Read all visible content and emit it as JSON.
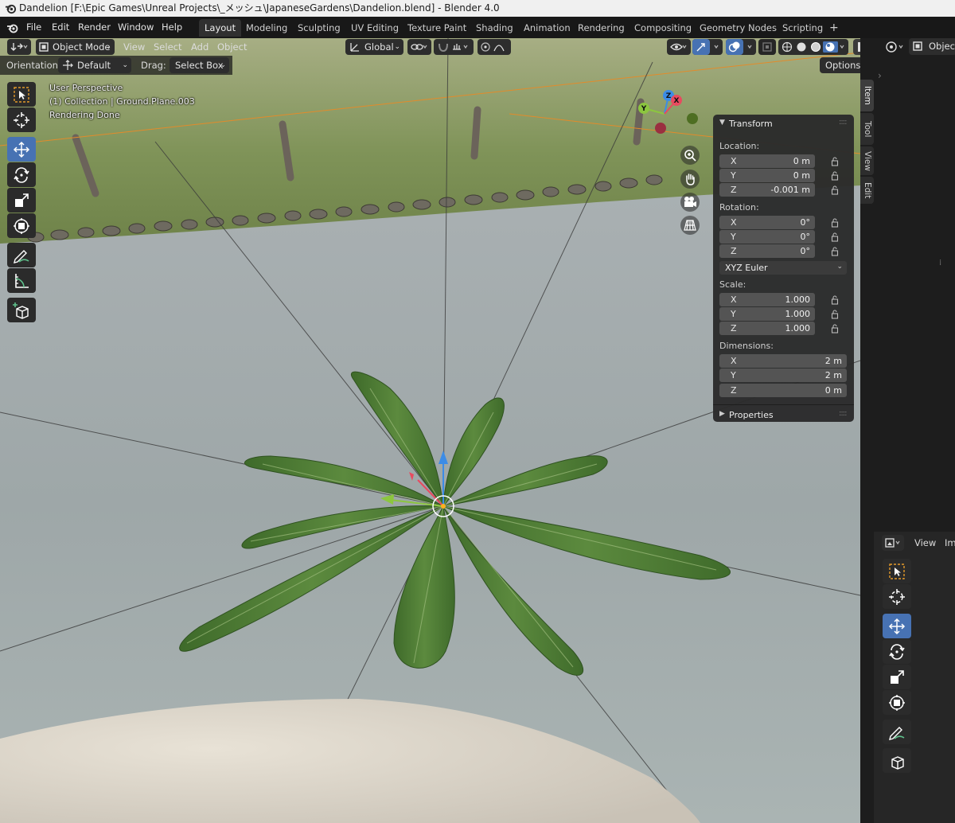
{
  "window_title": "Dandelion [F:\\Epic Games\\Unreal Projects\\_メッシュ\\JapaneseGardens\\Dandelion.blend] - Blender 4.0",
  "menu": [
    "File",
    "Edit",
    "Render",
    "Window",
    "Help"
  ],
  "workspaces": [
    "Layout",
    "Modeling",
    "Sculpting",
    "UV Editing",
    "Texture Paint",
    "Shading",
    "Animation",
    "Rendering",
    "Compositing",
    "Geometry Nodes",
    "Scripting"
  ],
  "add_workspace": "+",
  "viewport_header": {
    "mode": "Object Mode",
    "menus": [
      "View",
      "Select",
      "Add",
      "Object"
    ],
    "transform_orientation": "Global",
    "orientation_label": "Orientation:",
    "orientation_value": "Default",
    "drag_label": "Drag:",
    "drag_value": "Select Box",
    "options": "Options"
  },
  "overlay": {
    "line1": "User Perspective",
    "line2": "(1) Collection | Ground.Plane.003",
    "line3": "Rendering Done"
  },
  "gizmo": {
    "x": "X",
    "y": "Y",
    "z": "Z"
  },
  "transform_panel": {
    "title": "Transform",
    "location_label": "Location:",
    "location": [
      {
        "axis": "X",
        "value": "0 m"
      },
      {
        "axis": "Y",
        "value": "0 m"
      },
      {
        "axis": "Z",
        "value": "-0.001 m"
      }
    ],
    "rotation_label": "Rotation:",
    "rotation": [
      {
        "axis": "X",
        "value": "0°"
      },
      {
        "axis": "Y",
        "value": "0°"
      },
      {
        "axis": "Z",
        "value": "0°"
      }
    ],
    "rotation_mode": "XYZ Euler",
    "scale_label": "Scale:",
    "scale": [
      {
        "axis": "X",
        "value": "1.000"
      },
      {
        "axis": "Y",
        "value": "1.000"
      },
      {
        "axis": "Z",
        "value": "1.000"
      }
    ],
    "dimensions_label": "Dimensions:",
    "dimensions": [
      {
        "axis": "X",
        "value": "2 m"
      },
      {
        "axis": "Y",
        "value": "2 m"
      },
      {
        "axis": "Z",
        "value": "0 m"
      }
    ],
    "properties_title": "Properties"
  },
  "sidebar_tabs": [
    "Item",
    "Tool",
    "View",
    "Edit"
  ],
  "right_editor": {
    "header_label": "Object",
    "view_label": "View",
    "clipped_label": "Im"
  },
  "colors": {
    "accent_blue": "#4772b3",
    "panel_bg": "#2b2b2b",
    "field_bg": "#545454",
    "axis_x": "#e84a5f",
    "axis_y": "#8cc63f",
    "axis_z": "#3c8ce6"
  }
}
